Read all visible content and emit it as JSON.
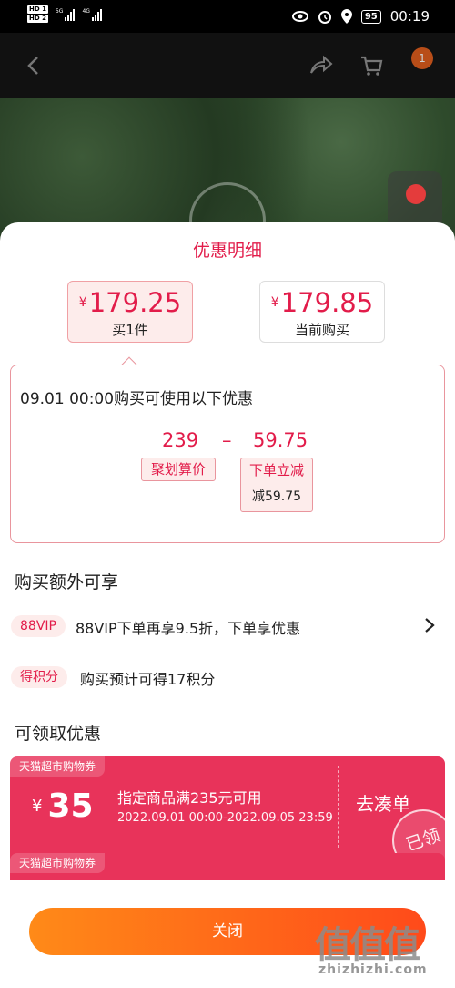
{
  "status_bar": {
    "hd1": "HD 1",
    "hd2": "HD 2",
    "net1": "5G",
    "net2": "4G",
    "battery": "95",
    "time": "00:19"
  },
  "top_bar": {
    "cart_badge": "1"
  },
  "sheet": {
    "title": "优惠明细",
    "price_cards": [
      {
        "currency": "¥",
        "amount": "179.25",
        "label": "买1件"
      },
      {
        "currency": "¥",
        "amount": "179.85",
        "label": "当前购买"
      }
    ],
    "calc": {
      "heading": "09.01 00:00购买可使用以下优惠",
      "base": "239",
      "operator": "–",
      "discount": "59.75",
      "base_tag": "聚划算价",
      "discount_tag": "下单立减",
      "discount_detail": "减59.75"
    },
    "extra_title": "购买额外可享",
    "extras": [
      {
        "badge": "88VIP",
        "text": "88VIP下单再享9.5折，下单享优惠"
      },
      {
        "badge": "得积分",
        "text": "购买预计可得17积分"
      }
    ],
    "coupons_title": "可领取优惠",
    "coupons": [
      {
        "label": "天猫超市购物券",
        "currency": "¥",
        "amount": "35",
        "desc": "指定商品满235元可用",
        "date": "2022.09.01 00:00-2022.09.05 23:59",
        "action": "去凑单",
        "stamp": "已领"
      },
      {
        "label": "天猫超市购物券"
      }
    ],
    "close_label": "关闭"
  },
  "watermark": {
    "brand": "值值值",
    "url": "zhizhizhi.com"
  },
  "colors": {
    "accent": "#e21c4a",
    "coupon": "#e8335a",
    "button_start": "#ff8a18",
    "button_end": "#ff4a1a"
  }
}
